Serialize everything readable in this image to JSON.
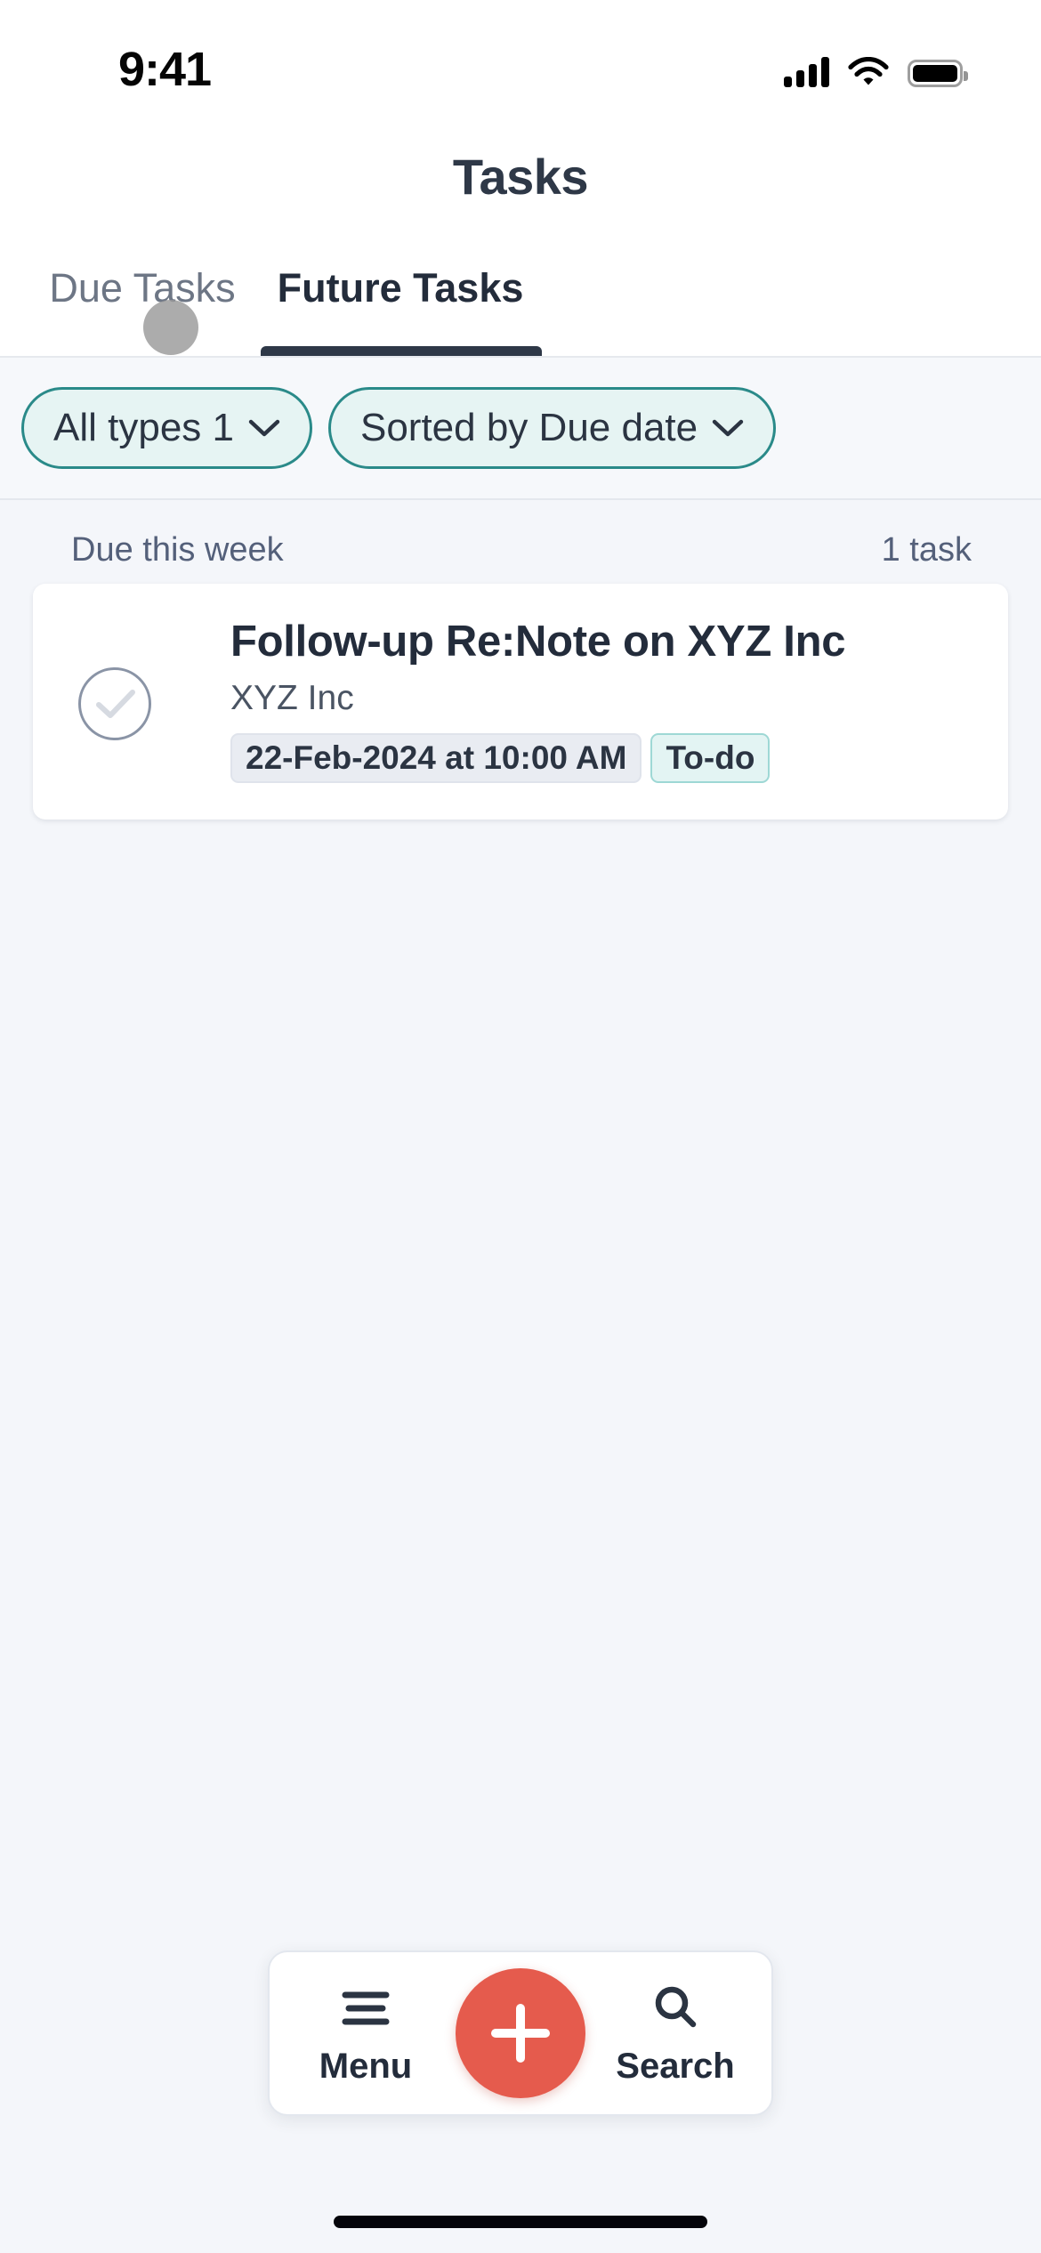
{
  "status_bar": {
    "time": "9:41",
    "cellular_icon": "cellular-signal-icon",
    "wifi_icon": "wifi-icon",
    "battery_icon": "battery-full-icon"
  },
  "header": {
    "title": "Tasks"
  },
  "tabs": [
    {
      "label": "Due Tasks",
      "active": false
    },
    {
      "label": "Future Tasks",
      "active": true
    }
  ],
  "filters": {
    "type_filter": {
      "label": "All types 1",
      "chevron_icon": "chevron-down-icon"
    },
    "sort_filter": {
      "label": "Sorted by Due date",
      "chevron_icon": "chevron-down-icon"
    }
  },
  "section": {
    "title": "Due this week",
    "count": "1 task"
  },
  "task": {
    "checkbox_icon": "check-circle-icon",
    "title": "Follow-up Re:Note on XYZ Inc",
    "subtitle": "XYZ Inc",
    "date_badge": "22-Feb-2024 at 10:00 AM",
    "status_badge": "To-do"
  },
  "bottom_nav": {
    "menu": {
      "label": "Menu",
      "icon": "hamburger-menu-icon"
    },
    "add": {
      "icon": "plus-icon"
    },
    "search": {
      "label": "Search",
      "icon": "search-icon"
    }
  },
  "colors": {
    "accent_teal": "#2a8a89",
    "chip_fill": "#e6f4f3",
    "fab_red": "#e55b4d",
    "text_dark": "#232c3b",
    "text_muted": "#54607a",
    "page_bg": "#f4f6fa"
  }
}
